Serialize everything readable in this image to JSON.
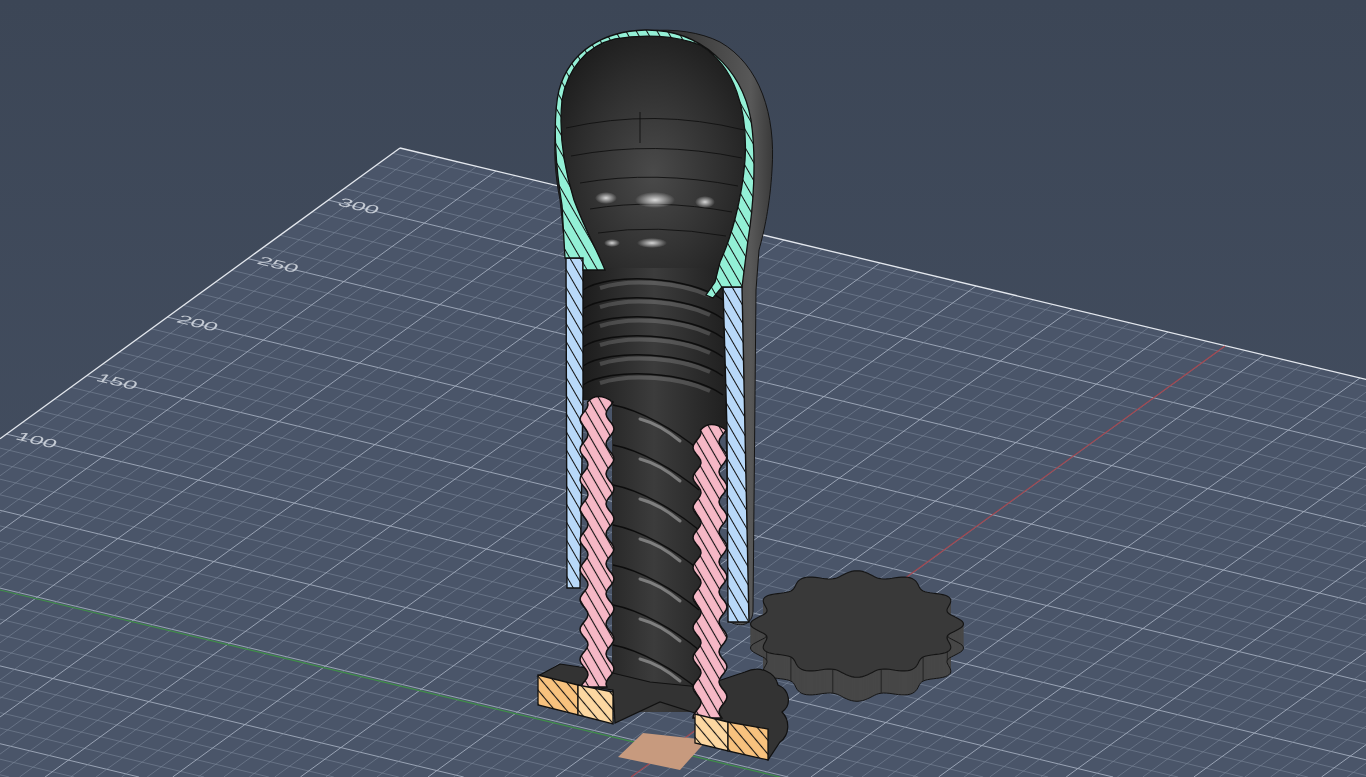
{
  "viewport": {
    "grid_labels": [
      "300",
      "250",
      "200",
      "150",
      "100"
    ]
  }
}
